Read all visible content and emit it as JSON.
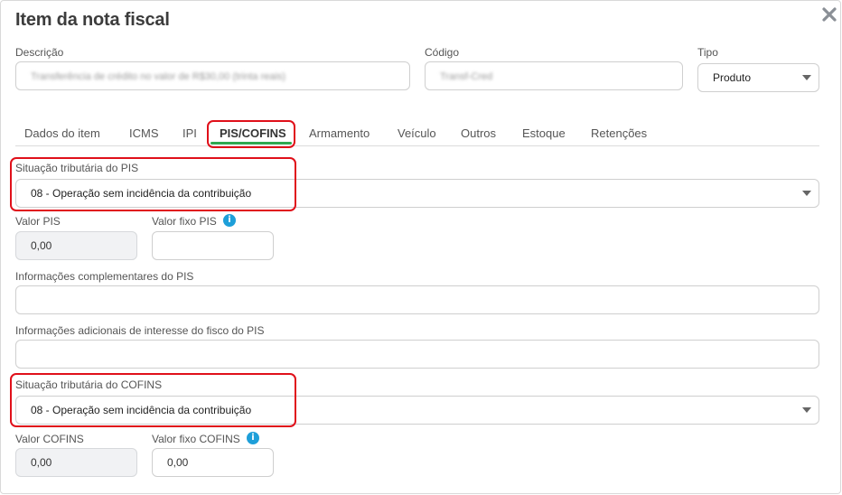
{
  "modal": {
    "title": "Item da nota fiscal",
    "close_icon": "close-icon"
  },
  "header_fields": {
    "descricao": {
      "label": "Descrição",
      "value": "Transferência de crédito no valor de R$30,00 (trinta reais)"
    },
    "codigo": {
      "label": "Código",
      "value": "Transf-Cred"
    },
    "tipo": {
      "label": "Tipo",
      "value": "Produto"
    }
  },
  "tabs": [
    {
      "label": "Dados do item"
    },
    {
      "label": "ICMS"
    },
    {
      "label": "IPI"
    },
    {
      "label": "PIS/COFINS",
      "active": true
    },
    {
      "label": "Armamento"
    },
    {
      "label": "Veículo"
    },
    {
      "label": "Outros"
    },
    {
      "label": "Estoque"
    },
    {
      "label": "Retenções"
    }
  ],
  "pis": {
    "situacao_label": "Situação tributária do PIS",
    "situacao_value": "08 - Operação sem incidência da contribuição",
    "valor_label": "Valor PIS",
    "valor_value": "0,00",
    "valor_fixo_label": "Valor fixo PIS",
    "valor_fixo_value": "",
    "info_complementares_label": "Informações complementares do PIS",
    "info_complementares_value": "",
    "info_adicionais_label": "Informações adicionais de interesse do fisco do PIS",
    "info_adicionais_value": ""
  },
  "cofins": {
    "situacao_label": "Situação tributária do COFINS",
    "situacao_value": "08 - Operação sem incidência da contribuição",
    "valor_label": "Valor COFINS",
    "valor_value": "0,00",
    "valor_fixo_label": "Valor fixo COFINS",
    "valor_fixo_value": "0,00"
  },
  "info_icon_glyph": "i",
  "colors": {
    "accent_green": "#2fa84f",
    "highlight_red": "#e0101a",
    "info_blue": "#1e9fd9"
  }
}
